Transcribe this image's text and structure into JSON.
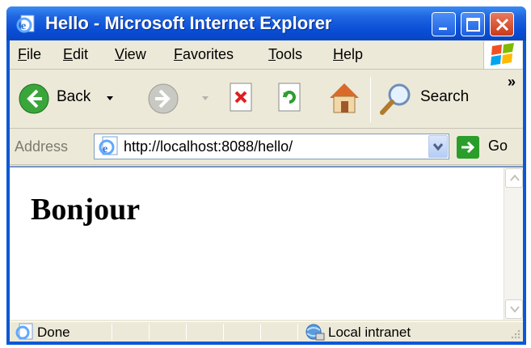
{
  "window": {
    "title": "Hello - Microsoft Internet Explorer",
    "icon": "ie-page-icon",
    "controls": [
      "minimize-icon",
      "maximize-icon",
      "close-icon"
    ]
  },
  "menubar": {
    "items": [
      "File",
      "Edit",
      "View",
      "Favorites",
      "Tools",
      "Help"
    ]
  },
  "toolbar": {
    "back_label": "Back",
    "search_label": "Search",
    "overflow": "»",
    "icons": [
      "back-arrow-icon",
      "forward-arrow-icon",
      "stop-icon",
      "refresh-icon",
      "home-icon",
      "search-magnifier-icon"
    ]
  },
  "addressbar": {
    "label": "Address",
    "url": "http://localhost:8088/hello/",
    "go_label": "Go"
  },
  "page": {
    "heading": "Bonjour"
  },
  "statusbar": {
    "status": "Done",
    "zone": "Local intranet"
  },
  "colors": {
    "titlebar": "#0a4ed6",
    "chrome": "#ece9d8",
    "go_green": "#2a9d2a"
  }
}
